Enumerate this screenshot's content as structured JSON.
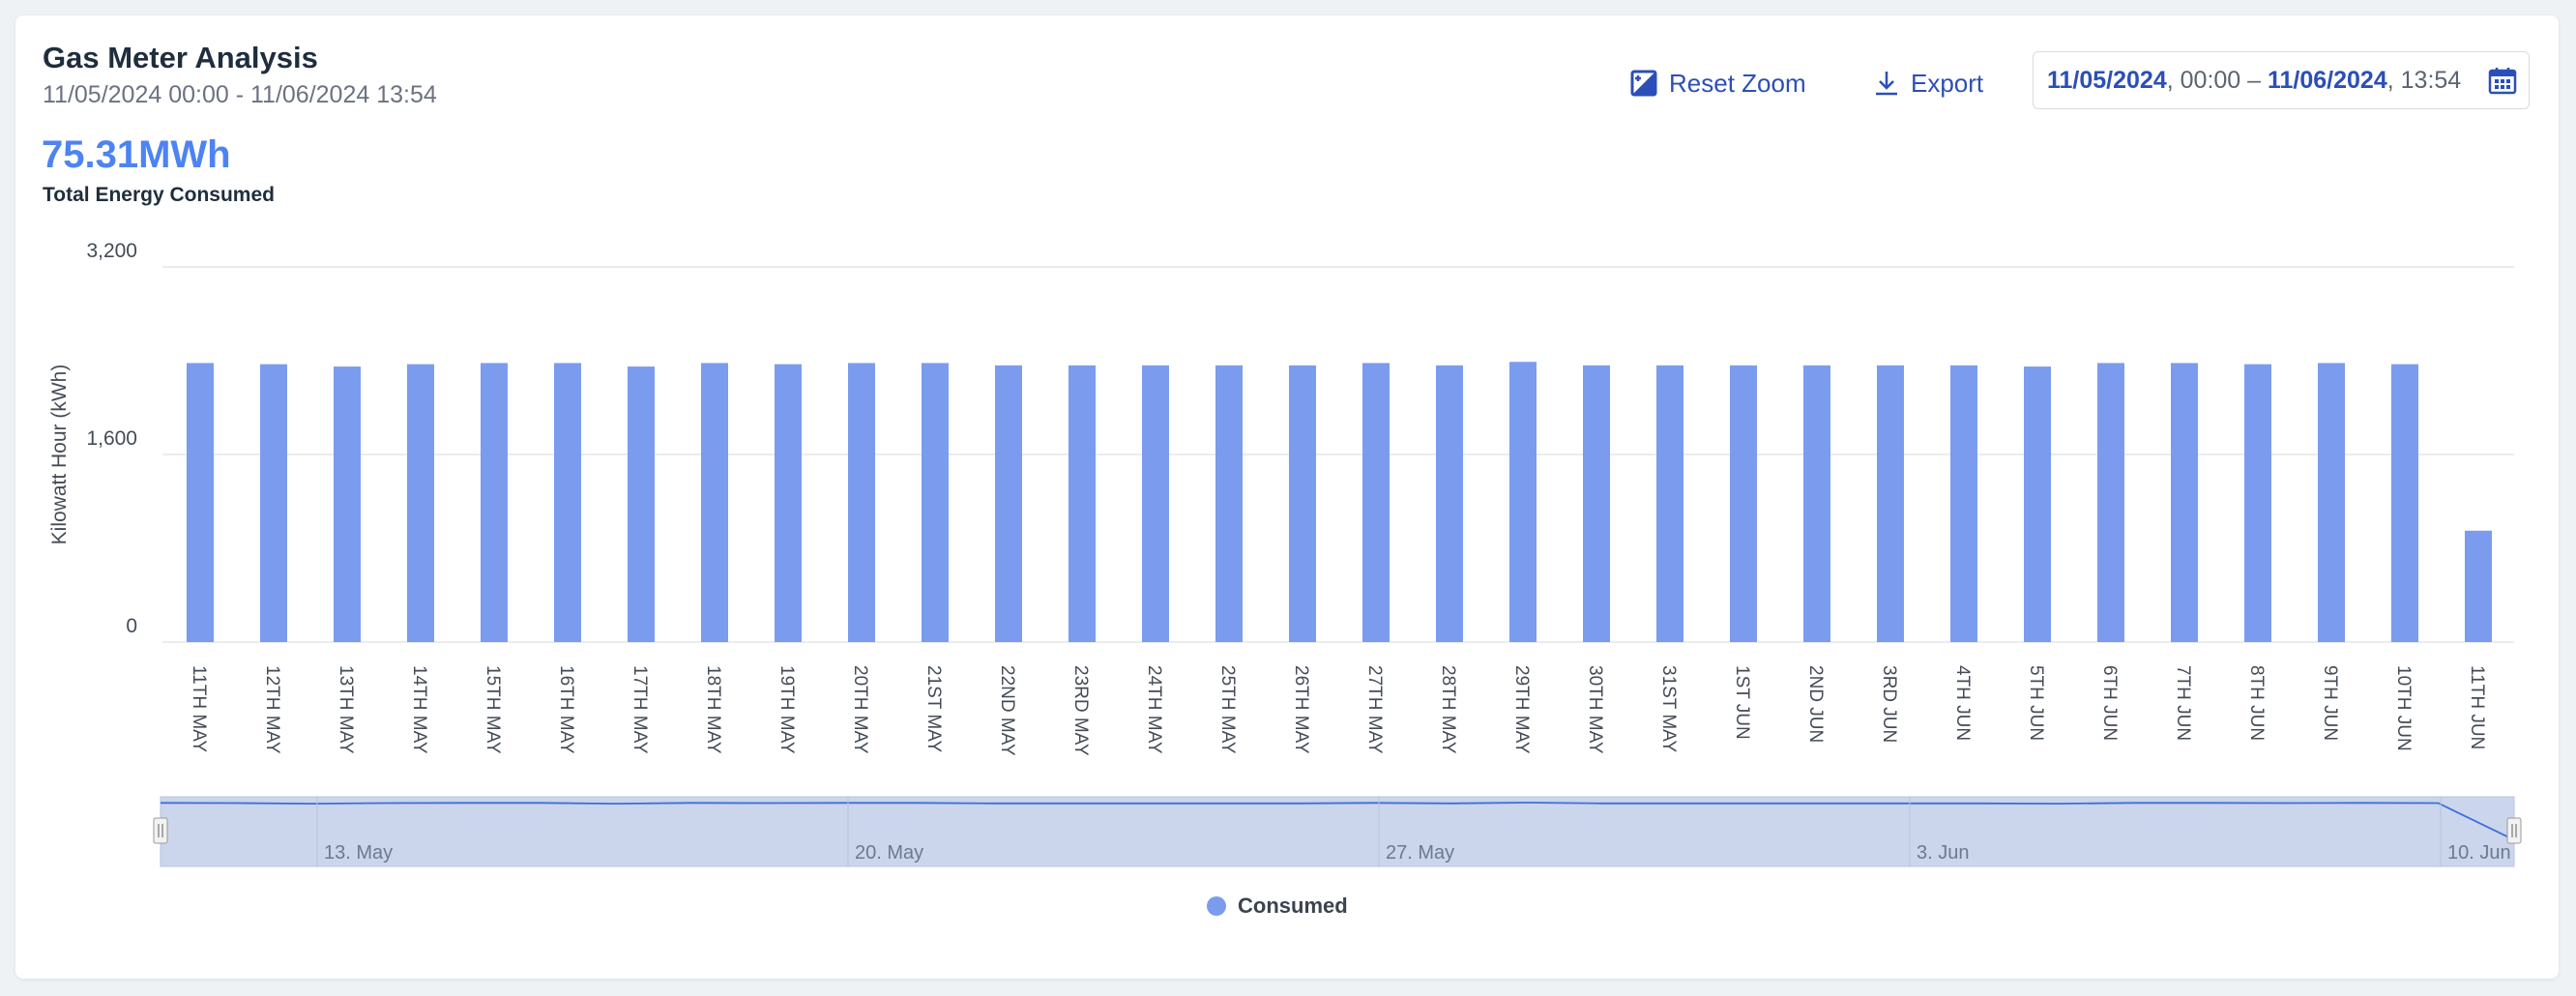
{
  "header": {
    "title": "Gas Meter Analysis",
    "subtitle": "11/05/2024 00:00 - 11/06/2024 13:54"
  },
  "kpi": {
    "value": "75.31MWh",
    "label": "Total Energy Consumed"
  },
  "toolbar": {
    "reset_zoom_label": "Reset Zoom",
    "export_label": "Export"
  },
  "date_range": {
    "start_date": "11/05/2024",
    "start_time": ", 00:00 – ",
    "end_date": "11/06/2024",
    "end_time": ", 13:54"
  },
  "colors": {
    "bar": "#7b9cee",
    "accent": "#4d83f2",
    "navigator_fill": "#cbd5ec",
    "navigator_line": "#3f6fd6"
  },
  "chart_data": {
    "type": "bar",
    "title": "",
    "ylabel": "Kilowatt Hour (kWh)",
    "xlabel": "",
    "ylim": [
      0,
      3200
    ],
    "yticks": [
      "0",
      "1,600",
      "3,200"
    ],
    "grid": true,
    "legend": "bottom-center",
    "categories": [
      "11TH MAY",
      "12TH MAY",
      "13TH MAY",
      "14TH MAY",
      "15TH MAY",
      "16TH MAY",
      "17TH MAY",
      "18TH MAY",
      "19TH MAY",
      "20TH MAY",
      "21ST MAY",
      "22ND MAY",
      "23RD MAY",
      "24TH MAY",
      "25TH MAY",
      "26TH MAY",
      "27TH MAY",
      "28TH MAY",
      "29TH MAY",
      "30TH MAY",
      "31ST MAY",
      "1ST JUN",
      "2ND JUN",
      "3RD JUN",
      "4TH JUN",
      "5TH JUN",
      "6TH JUN",
      "7TH JUN",
      "8TH JUN",
      "9TH JUN",
      "10TH JUN",
      "11TH JUN"
    ],
    "series": [
      {
        "name": "Consumed",
        "values": [
          2380,
          2370,
          2350,
          2370,
          2380,
          2380,
          2350,
          2380,
          2370,
          2380,
          2380,
          2360,
          2360,
          2360,
          2360,
          2360,
          2380,
          2360,
          2390,
          2360,
          2360,
          2360,
          2360,
          2360,
          2360,
          2350,
          2380,
          2380,
          2370,
          2380,
          2370,
          950
        ]
      }
    ],
    "navigator": {
      "labels": [
        "13. May",
        "20. May",
        "27. May",
        "3. Jun",
        "10. Jun"
      ]
    }
  }
}
